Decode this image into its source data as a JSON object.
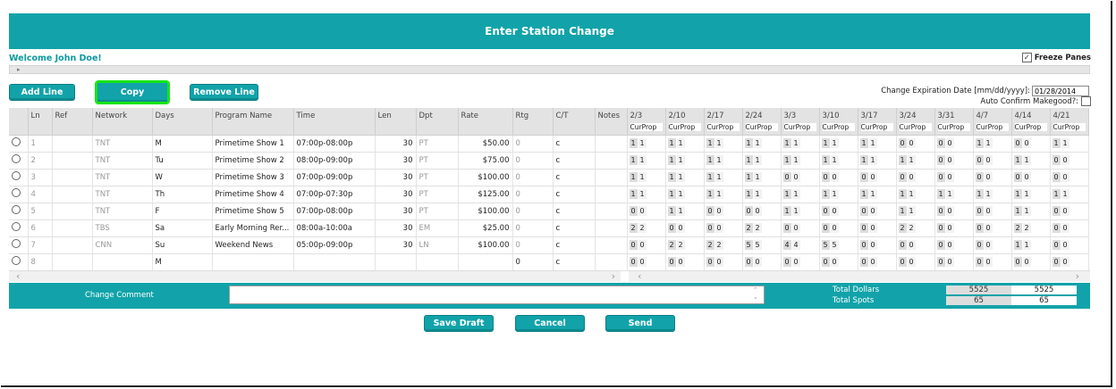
{
  "header": {
    "title": "Enter Station Change"
  },
  "welcome": "Welcome John Doe!",
  "freeze": {
    "label": "Freeze Panes",
    "checked": "✓"
  },
  "toolbar": {
    "add_line": "Add Line",
    "copy": "Copy",
    "remove_line": "Remove Line"
  },
  "expiration": {
    "label": "Change Expiration Date [mm/dd/yyyy]:",
    "value": "01/28/2014"
  },
  "auto_confirm": {
    "label": "Auto Confirm Makegood?:"
  },
  "columns": [
    "Ln",
    "Ref",
    "Network",
    "Days",
    "Program Name",
    "Time",
    "Len",
    "Dpt",
    "Rate",
    "Rtg",
    "C/T",
    "Notes"
  ],
  "weeks": [
    "2/3",
    "2/10",
    "2/17",
    "2/24",
    "3/3",
    "3/10",
    "3/17",
    "3/24",
    "3/31",
    "4/7",
    "4/14",
    "4/21"
  ],
  "week_sub": "CurProp",
  "rows": [
    {
      "ln": "1",
      "ref": "",
      "network": "TNT",
      "days": "M",
      "program": "Primetime Show 1",
      "time": "07:00p-08:00p",
      "len": "30",
      "dpt": "PT",
      "rate": "$50.00",
      "rtg": "0",
      "ct": "c",
      "notes": "",
      "weeks": [
        [
          "1",
          "1"
        ],
        [
          "1",
          "1"
        ],
        [
          "1",
          "1"
        ],
        [
          "1",
          "1"
        ],
        [
          "1",
          "1"
        ],
        [
          "1",
          "1"
        ],
        [
          "1",
          "1"
        ],
        [
          "0",
          "0"
        ],
        [
          "0",
          "0"
        ],
        [
          "1",
          "1"
        ],
        [
          "0",
          "0"
        ],
        [
          "1",
          "1"
        ]
      ]
    },
    {
      "ln": "2",
      "ref": "",
      "network": "TNT",
      "days": "Tu",
      "program": "Primetime Show 2",
      "time": "08:00p-09:00p",
      "len": "30",
      "dpt": "PT",
      "rate": "$75.00",
      "rtg": "0",
      "ct": "c",
      "notes": "",
      "weeks": [
        [
          "1",
          "1"
        ],
        [
          "1",
          "1"
        ],
        [
          "1",
          "1"
        ],
        [
          "1",
          "1"
        ],
        [
          "1",
          "1"
        ],
        [
          "1",
          "1"
        ],
        [
          "1",
          "1"
        ],
        [
          "1",
          "1"
        ],
        [
          "0",
          "0"
        ],
        [
          "0",
          "0"
        ],
        [
          "1",
          "1"
        ],
        [
          "0",
          "0"
        ]
      ]
    },
    {
      "ln": "3",
      "ref": "",
      "network": "TNT",
      "days": "W",
      "program": "Primetime Show 3",
      "time": "07:00p-09:00p",
      "len": "30",
      "dpt": "PT",
      "rate": "$100.00",
      "rtg": "0",
      "ct": "c",
      "notes": "",
      "weeks": [
        [
          "1",
          "1"
        ],
        [
          "1",
          "1"
        ],
        [
          "1",
          "1"
        ],
        [
          "1",
          "1"
        ],
        [
          "0",
          "0"
        ],
        [
          "0",
          "0"
        ],
        [
          "0",
          "0"
        ],
        [
          "0",
          "0"
        ],
        [
          "0",
          "0"
        ],
        [
          "0",
          "0"
        ],
        [
          "0",
          "0"
        ],
        [
          "0",
          "0"
        ]
      ]
    },
    {
      "ln": "4",
      "ref": "",
      "network": "TNT",
      "days": "Th",
      "program": "Primetime Show 4",
      "time": "07:00p-07:30p",
      "len": "30",
      "dpt": "PT",
      "rate": "$125.00",
      "rtg": "0",
      "ct": "c",
      "notes": "",
      "weeks": [
        [
          "1",
          "1"
        ],
        [
          "1",
          "1"
        ],
        [
          "1",
          "1"
        ],
        [
          "1",
          "1"
        ],
        [
          "1",
          "1"
        ],
        [
          "1",
          "1"
        ],
        [
          "1",
          "1"
        ],
        [
          "1",
          "1"
        ],
        [
          "1",
          "1"
        ],
        [
          "1",
          "1"
        ],
        [
          "1",
          "1"
        ],
        [
          "1",
          "1"
        ]
      ]
    },
    {
      "ln": "5",
      "ref": "",
      "network": "TNT",
      "days": "F",
      "program": "Primetime Show 5",
      "time": "07:00p-08:00p",
      "len": "30",
      "dpt": "PT",
      "rate": "$100.00",
      "rtg": "0",
      "ct": "c",
      "notes": "",
      "weeks": [
        [
          "0",
          "0"
        ],
        [
          "1",
          "1"
        ],
        [
          "0",
          "0"
        ],
        [
          "0",
          "0"
        ],
        [
          "1",
          "1"
        ],
        [
          "0",
          "0"
        ],
        [
          "0",
          "0"
        ],
        [
          "1",
          "1"
        ],
        [
          "0",
          "0"
        ],
        [
          "0",
          "0"
        ],
        [
          "1",
          "1"
        ],
        [
          "0",
          "0"
        ]
      ]
    },
    {
      "ln": "6",
      "ref": "",
      "network": "TBS",
      "days": "Sa",
      "program": "Early Morning Rer...",
      "time": "08:00a-10:00a",
      "len": "30",
      "dpt": "EM",
      "rate": "$25.00",
      "rtg": "0",
      "ct": "c",
      "notes": "",
      "weeks": [
        [
          "2",
          "2"
        ],
        [
          "0",
          "0"
        ],
        [
          "0",
          "0"
        ],
        [
          "2",
          "2"
        ],
        [
          "0",
          "0"
        ],
        [
          "0",
          "0"
        ],
        [
          "0",
          "0"
        ],
        [
          "2",
          "2"
        ],
        [
          "0",
          "0"
        ],
        [
          "0",
          "0"
        ],
        [
          "2",
          "2"
        ],
        [
          "0",
          "0"
        ]
      ]
    },
    {
      "ln": "7",
      "ref": "",
      "network": "CNN",
      "days": "Su",
      "program": "Weekend News",
      "time": "05:00p-09:00p",
      "len": "30",
      "dpt": "LN",
      "rate": "$100.00",
      "rtg": "0",
      "ct": "c",
      "notes": "",
      "weeks": [
        [
          "0",
          "0"
        ],
        [
          "2",
          "2"
        ],
        [
          "2",
          "2"
        ],
        [
          "5",
          "5"
        ],
        [
          "4",
          "4"
        ],
        [
          "5",
          "5"
        ],
        [
          "0",
          "0"
        ],
        [
          "0",
          "0"
        ],
        [
          "0",
          "0"
        ],
        [
          "0",
          "0"
        ],
        [
          "1",
          "1"
        ],
        [
          "0",
          "0"
        ]
      ]
    },
    {
      "ln": "8",
      "ref": "",
      "network": "",
      "days": "M",
      "program": "",
      "time": "",
      "len": "",
      "dpt": "",
      "rate": "",
      "rtg": "0",
      "ct": "c",
      "notes": "",
      "weeks": [
        [
          "0",
          "0"
        ],
        [
          "0",
          "0"
        ],
        [
          "0",
          "0"
        ],
        [
          "0",
          "0"
        ],
        [
          "0",
          "0"
        ],
        [
          "0",
          "0"
        ],
        [
          "0",
          "0"
        ],
        [
          "0",
          "0"
        ],
        [
          "0",
          "0"
        ],
        [
          "0",
          "0"
        ],
        [
          "0",
          "0"
        ],
        [
          "0",
          "0"
        ]
      ]
    }
  ],
  "footer": {
    "comment_label": "Change Comment",
    "total_dollars_label": "Total Dollars",
    "total_spots_label": "Total Spots",
    "total_dollars": [
      "5525",
      "5525"
    ],
    "total_spots": [
      "65",
      "65"
    ]
  },
  "actions": {
    "save_draft": "Save Draft",
    "cancel": "Cancel",
    "send": "Send"
  }
}
